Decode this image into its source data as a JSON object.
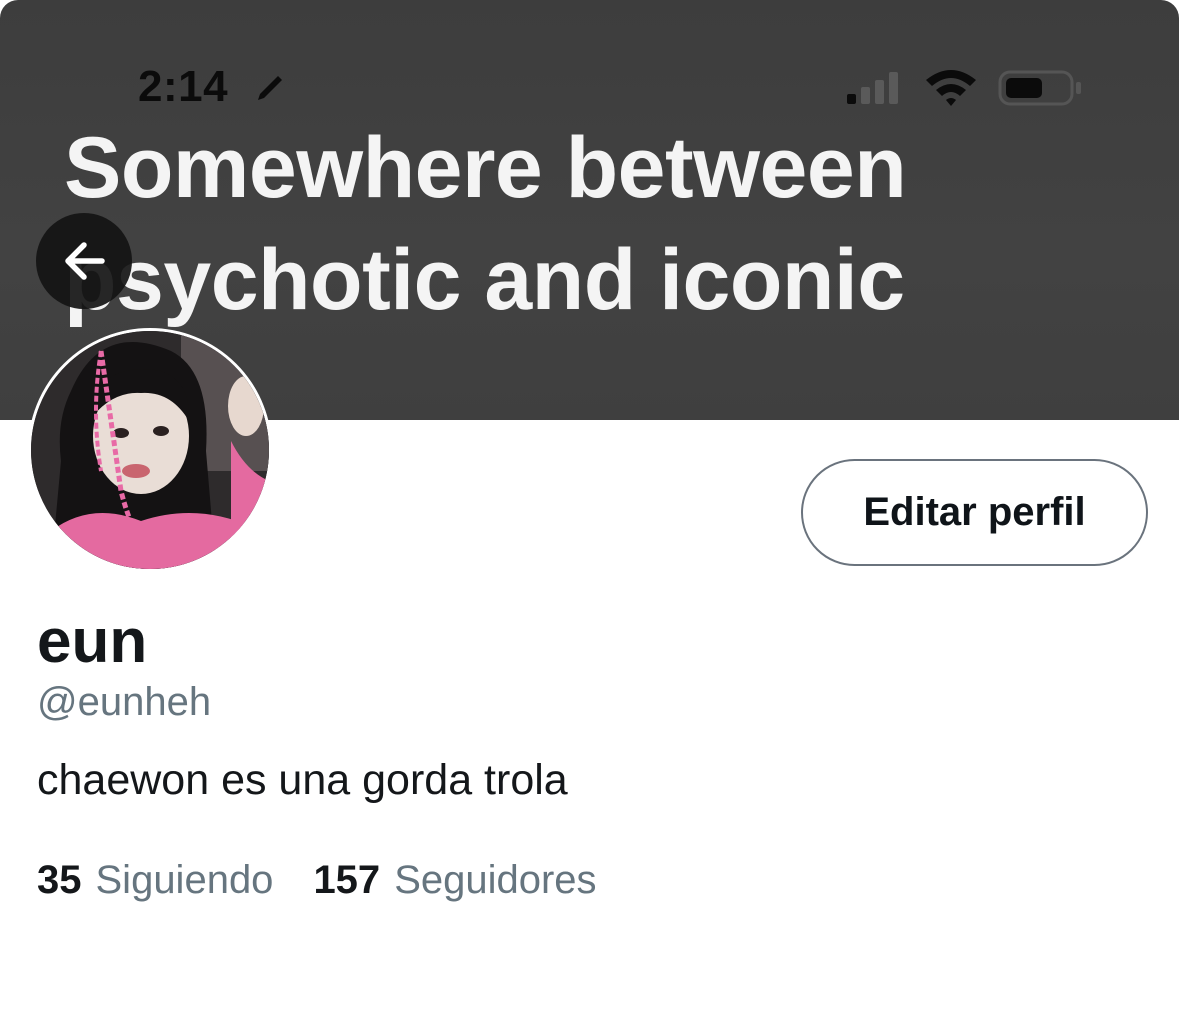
{
  "status_bar": {
    "time": "2:14",
    "icons": [
      "pencil-icon",
      "signal-icon",
      "wifi-icon",
      "battery-icon"
    ]
  },
  "banner": {
    "text": "Somewhere between\npsychotic and iconic",
    "background": "#404040"
  },
  "nav": {
    "back_icon": "arrow-left-icon"
  },
  "profile": {
    "edit_button_label": "Editar perfil",
    "display_name": "eun",
    "handle": "@eunheh",
    "bio": "chaewon es una gorda trola",
    "following_count": "35",
    "following_label": "Siguiendo",
    "followers_count": "157",
    "followers_label": "Seguidores"
  },
  "colors": {
    "text_primary": "#14171a",
    "text_secondary": "#66757f",
    "button_border": "#6a737d",
    "avatar_accent_pink": "#e86aa6"
  }
}
